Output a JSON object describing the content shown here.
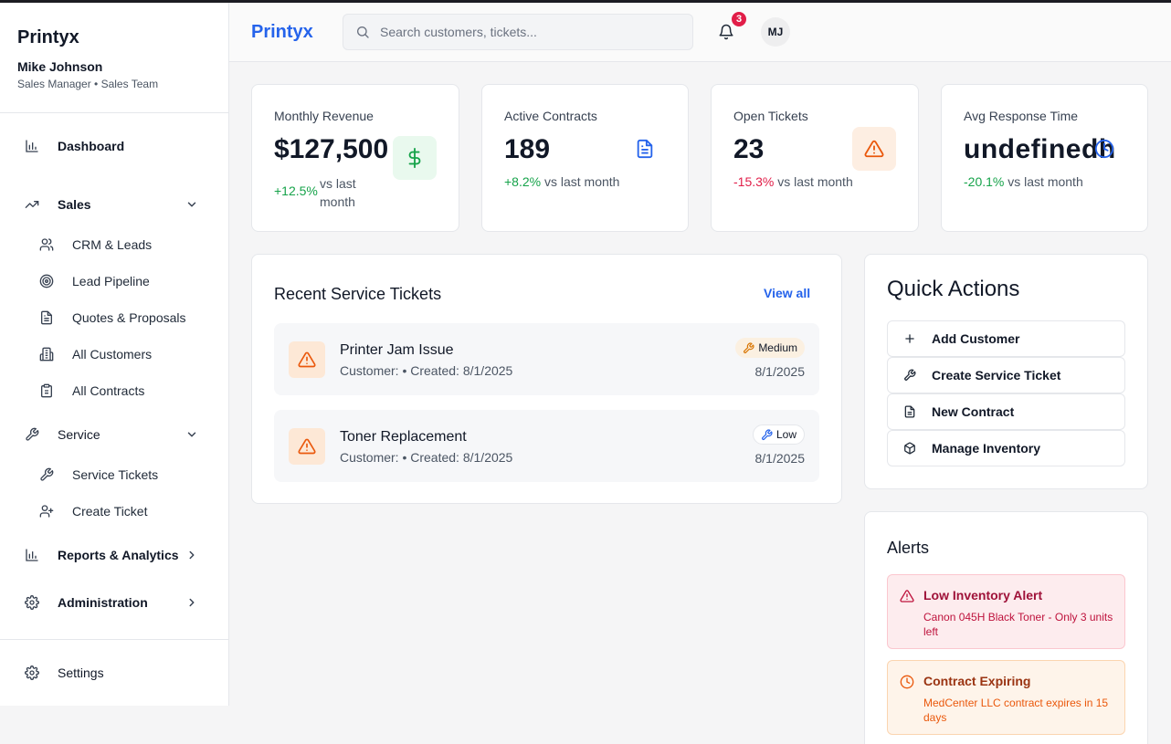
{
  "sidebar": {
    "brand": "Printyx",
    "user_name": "Mike Johnson",
    "user_role": "Sales Manager • Sales Team",
    "dashboard": "Dashboard",
    "sales": "Sales",
    "sales_items": [
      "CRM & Leads",
      "Lead Pipeline",
      "Quotes & Proposals",
      "All Customers",
      "All Contracts"
    ],
    "service": "Service",
    "service_items": [
      "Service Tickets",
      "Create Ticket"
    ],
    "reports": "Reports & Analytics",
    "administration": "Administration",
    "settings": "Settings"
  },
  "header": {
    "brand": "Printyx",
    "search_placeholder": "Search customers, tickets...",
    "notification_count": "3",
    "avatar_initials": "MJ"
  },
  "stats": [
    {
      "title": "Monthly Revenue",
      "value": "$127,500",
      "change": "+12.5%",
      "suffix": "vs last month",
      "icon": "dollar-icon",
      "trend": "up"
    },
    {
      "title": "Active Contracts",
      "value": "189",
      "change": "+8.2%",
      "suffix": "vs last month",
      "icon": "document-icon",
      "trend": "up"
    },
    {
      "title": "Open Tickets",
      "value": "23",
      "change": "-15.3%",
      "suffix": "vs last month",
      "icon": "warning-icon",
      "trend": "down"
    },
    {
      "title": "Avg Response Time",
      "value": "undefinedh",
      "change": "-20.1%",
      "suffix": "vs last month",
      "icon": "clock-icon",
      "trend": "up"
    }
  ],
  "tickets": {
    "title": "Recent Service Tickets",
    "view_all": "View all",
    "items": [
      {
        "title": "Printer Jam Issue",
        "subtitle": "Customer: • Created: 8/1/2025",
        "priority": "Medium",
        "date": "8/1/2025"
      },
      {
        "title": "Toner Replacement",
        "subtitle": "Customer: • Created: 8/1/2025",
        "priority": "Low",
        "date": "8/1/2025"
      }
    ]
  },
  "quick_actions": {
    "title": "Quick Actions",
    "items": [
      {
        "label": "Add Customer",
        "icon": "plus-icon"
      },
      {
        "label": "Create Service Ticket",
        "icon": "wrench-icon"
      },
      {
        "label": "New Contract",
        "icon": "document-icon"
      },
      {
        "label": "Manage Inventory",
        "icon": "package-icon"
      }
    ]
  },
  "alerts": {
    "title": "Alerts",
    "items": [
      {
        "title": "Low Inventory Alert",
        "description": "Canon 045H Black Toner - Only 3 units left",
        "icon": "warning-icon",
        "color": "#be123c",
        "bg": "#fdecee",
        "border": "#fbc7cf"
      },
      {
        "title": "Contract Expiring",
        "description": "MedCenter LLC contract expires in 15 days",
        "icon": "clock-icon",
        "color": "#9a3412",
        "desc_color": "#ea580c",
        "bg": "#fef4ea",
        "border": "#fbd5b0"
      }
    ]
  },
  "colors": {
    "accent": "#2563eb",
    "positive": "#16a34a",
    "negative": "#e11d48",
    "warning": "#ea580c"
  }
}
